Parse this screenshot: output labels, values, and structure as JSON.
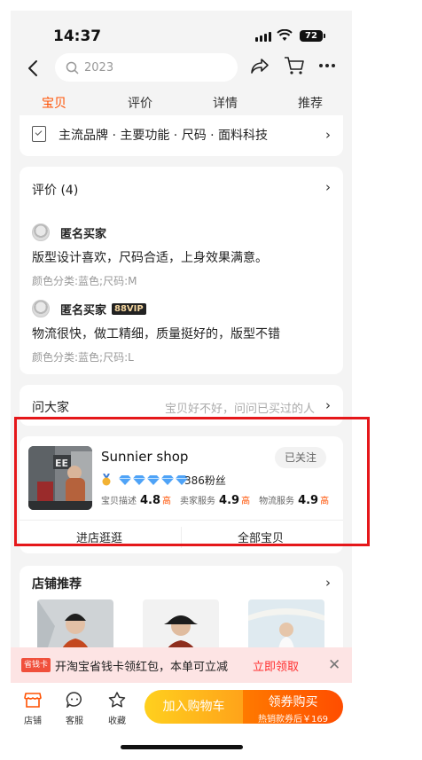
{
  "status_bar": {
    "time": "14:37",
    "battery": "72"
  },
  "search": {
    "query": "2023"
  },
  "tabs": [
    {
      "label": "宝贝",
      "active": true
    },
    {
      "label": "评价",
      "active": false
    },
    {
      "label": "详情",
      "active": false
    },
    {
      "label": "推荐",
      "active": false
    }
  ],
  "params_row": {
    "text": "主流品牌 · 主要功能 · 尺码 · 面料科技"
  },
  "reviews": {
    "title": "评价 (4)",
    "items": [
      {
        "user": "匿名买家",
        "vip": "",
        "text": "版型设计喜欢，尺码合适，上身效果满意。",
        "meta": "颜色分类:蓝色;尺码:M"
      },
      {
        "user": "匿名买家",
        "vip": "88VIP",
        "text": "物流很快，做工精细，质量挺好的，版型不错",
        "meta": "颜色分类:蓝色;尺码:L"
      }
    ]
  },
  "ask": {
    "title": "问大家",
    "hint": "宝贝好不好，问问已买过的人"
  },
  "shop": {
    "name": "Sunnier shop",
    "follow_label": "已关注",
    "fans": "386粉丝",
    "scores": [
      {
        "label": "宝贝描述",
        "value": "4.8",
        "level": "高"
      },
      {
        "label": "卖家服务",
        "value": "4.9",
        "level": "高"
      },
      {
        "label": "物流服务",
        "value": "4.9",
        "level": "高"
      }
    ],
    "enter_label": "进店逛逛",
    "all_label": "全部宝贝"
  },
  "recommend": {
    "title": "店铺推荐"
  },
  "promo": {
    "tag": "省钱卡",
    "message": "开淘宝省钱卡领红包，本单可立减",
    "cta": "立即领取"
  },
  "bottom_bar": {
    "store": "店铺",
    "service": "客服",
    "favorite": "收藏",
    "add_cart": "加入购物车",
    "buy_title": "领券购买",
    "buy_sub": "热销款券后￥169"
  },
  "colors": {
    "accent": "#ff5000",
    "highlight": "#e5171a"
  }
}
